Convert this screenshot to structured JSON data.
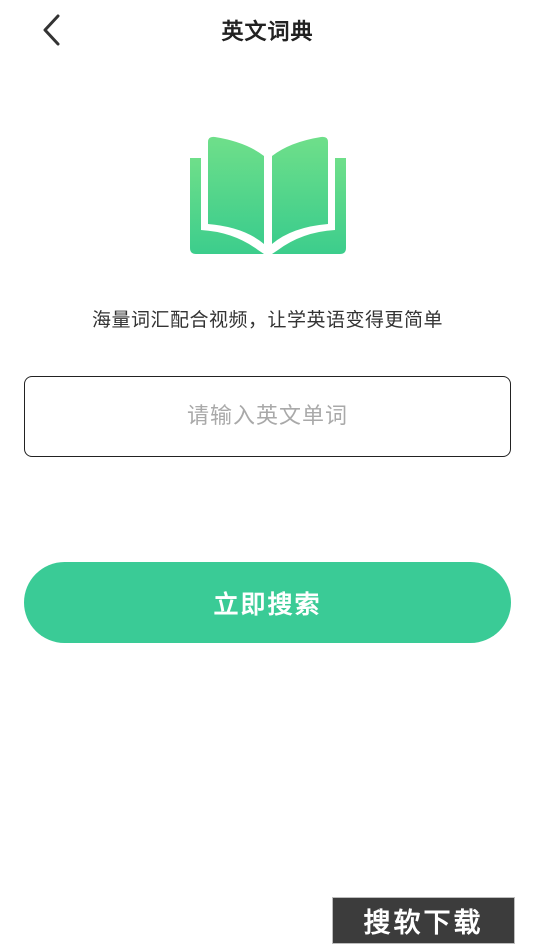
{
  "header": {
    "title": "英文词典",
    "back_icon": "chevron-left-icon"
  },
  "hero": {
    "logo_icon": "open-book-icon",
    "tagline": "海量词汇配合视频，让学英语变得更简单"
  },
  "search": {
    "placeholder": "请输入英文单词",
    "value": ""
  },
  "actions": {
    "search_label": "立即搜索"
  },
  "watermark": {
    "text": "搜软下载"
  },
  "colors": {
    "accent": "#3acb96",
    "logo_top": "#6fdf8a",
    "logo_bottom": "#3ccd8c",
    "text_primary": "#222222",
    "placeholder": "#a9a9a9"
  }
}
